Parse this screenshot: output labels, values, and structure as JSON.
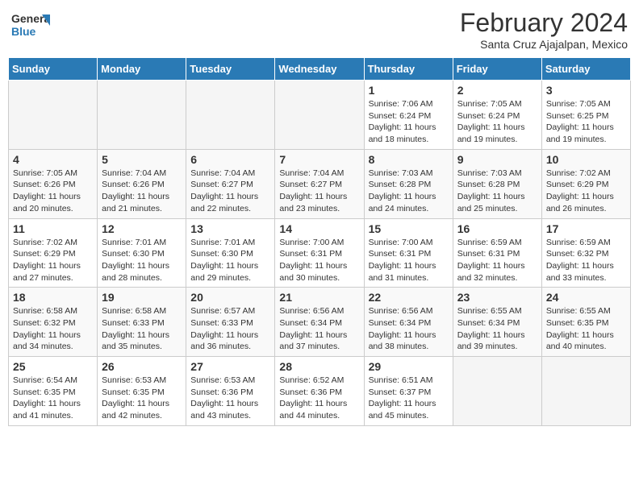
{
  "header": {
    "logo_general": "General",
    "logo_blue": "Blue",
    "month_title": "February 2024",
    "location": "Santa Cruz Ajajalpan, Mexico"
  },
  "weekdays": [
    "Sunday",
    "Monday",
    "Tuesday",
    "Wednesday",
    "Thursday",
    "Friday",
    "Saturday"
  ],
  "weeks": [
    [
      {
        "day": "",
        "info": ""
      },
      {
        "day": "",
        "info": ""
      },
      {
        "day": "",
        "info": ""
      },
      {
        "day": "",
        "info": ""
      },
      {
        "day": "1",
        "info": "Sunrise: 7:06 AM\nSunset: 6:24 PM\nDaylight: 11 hours and 18 minutes."
      },
      {
        "day": "2",
        "info": "Sunrise: 7:05 AM\nSunset: 6:24 PM\nDaylight: 11 hours and 19 minutes."
      },
      {
        "day": "3",
        "info": "Sunrise: 7:05 AM\nSunset: 6:25 PM\nDaylight: 11 hours and 19 minutes."
      }
    ],
    [
      {
        "day": "4",
        "info": "Sunrise: 7:05 AM\nSunset: 6:26 PM\nDaylight: 11 hours and 20 minutes."
      },
      {
        "day": "5",
        "info": "Sunrise: 7:04 AM\nSunset: 6:26 PM\nDaylight: 11 hours and 21 minutes."
      },
      {
        "day": "6",
        "info": "Sunrise: 7:04 AM\nSunset: 6:27 PM\nDaylight: 11 hours and 22 minutes."
      },
      {
        "day": "7",
        "info": "Sunrise: 7:04 AM\nSunset: 6:27 PM\nDaylight: 11 hours and 23 minutes."
      },
      {
        "day": "8",
        "info": "Sunrise: 7:03 AM\nSunset: 6:28 PM\nDaylight: 11 hours and 24 minutes."
      },
      {
        "day": "9",
        "info": "Sunrise: 7:03 AM\nSunset: 6:28 PM\nDaylight: 11 hours and 25 minutes."
      },
      {
        "day": "10",
        "info": "Sunrise: 7:02 AM\nSunset: 6:29 PM\nDaylight: 11 hours and 26 minutes."
      }
    ],
    [
      {
        "day": "11",
        "info": "Sunrise: 7:02 AM\nSunset: 6:29 PM\nDaylight: 11 hours and 27 minutes."
      },
      {
        "day": "12",
        "info": "Sunrise: 7:01 AM\nSunset: 6:30 PM\nDaylight: 11 hours and 28 minutes."
      },
      {
        "day": "13",
        "info": "Sunrise: 7:01 AM\nSunset: 6:30 PM\nDaylight: 11 hours and 29 minutes."
      },
      {
        "day": "14",
        "info": "Sunrise: 7:00 AM\nSunset: 6:31 PM\nDaylight: 11 hours and 30 minutes."
      },
      {
        "day": "15",
        "info": "Sunrise: 7:00 AM\nSunset: 6:31 PM\nDaylight: 11 hours and 31 minutes."
      },
      {
        "day": "16",
        "info": "Sunrise: 6:59 AM\nSunset: 6:31 PM\nDaylight: 11 hours and 32 minutes."
      },
      {
        "day": "17",
        "info": "Sunrise: 6:59 AM\nSunset: 6:32 PM\nDaylight: 11 hours and 33 minutes."
      }
    ],
    [
      {
        "day": "18",
        "info": "Sunrise: 6:58 AM\nSunset: 6:32 PM\nDaylight: 11 hours and 34 minutes."
      },
      {
        "day": "19",
        "info": "Sunrise: 6:58 AM\nSunset: 6:33 PM\nDaylight: 11 hours and 35 minutes."
      },
      {
        "day": "20",
        "info": "Sunrise: 6:57 AM\nSunset: 6:33 PM\nDaylight: 11 hours and 36 minutes."
      },
      {
        "day": "21",
        "info": "Sunrise: 6:56 AM\nSunset: 6:34 PM\nDaylight: 11 hours and 37 minutes."
      },
      {
        "day": "22",
        "info": "Sunrise: 6:56 AM\nSunset: 6:34 PM\nDaylight: 11 hours and 38 minutes."
      },
      {
        "day": "23",
        "info": "Sunrise: 6:55 AM\nSunset: 6:34 PM\nDaylight: 11 hours and 39 minutes."
      },
      {
        "day": "24",
        "info": "Sunrise: 6:55 AM\nSunset: 6:35 PM\nDaylight: 11 hours and 40 minutes."
      }
    ],
    [
      {
        "day": "25",
        "info": "Sunrise: 6:54 AM\nSunset: 6:35 PM\nDaylight: 11 hours and 41 minutes."
      },
      {
        "day": "26",
        "info": "Sunrise: 6:53 AM\nSunset: 6:35 PM\nDaylight: 11 hours and 42 minutes."
      },
      {
        "day": "27",
        "info": "Sunrise: 6:53 AM\nSunset: 6:36 PM\nDaylight: 11 hours and 43 minutes."
      },
      {
        "day": "28",
        "info": "Sunrise: 6:52 AM\nSunset: 6:36 PM\nDaylight: 11 hours and 44 minutes."
      },
      {
        "day": "29",
        "info": "Sunrise: 6:51 AM\nSunset: 6:37 PM\nDaylight: 11 hours and 45 minutes."
      },
      {
        "day": "",
        "info": ""
      },
      {
        "day": "",
        "info": ""
      }
    ]
  ]
}
